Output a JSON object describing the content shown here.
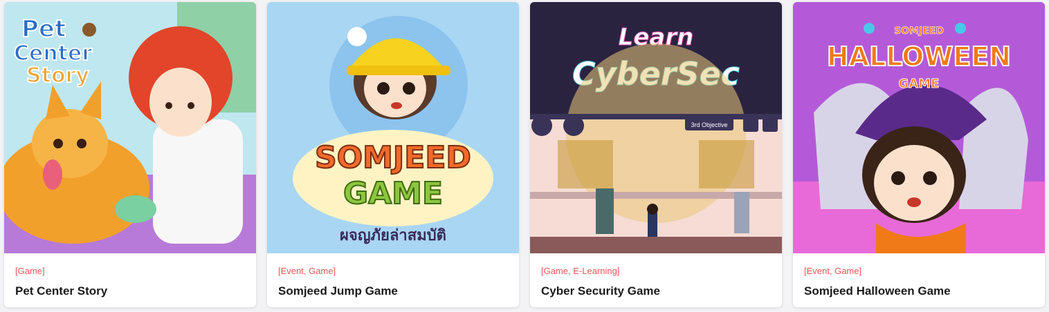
{
  "cards": [
    {
      "category": "[Game]",
      "title": "Pet Center Story",
      "art": {
        "logo_line1": "Pet",
        "logo_line2": "Center",
        "logo_line3": "Story",
        "bg": "#bfe7f0",
        "accent": "#f2a02c"
      }
    },
    {
      "category": "[Event, Game]",
      "title": "Somjeed Jump Game",
      "art": {
        "logo_line1": "SOMJEED",
        "logo_line2": "GAME",
        "subtitle_th": "ผจญภัยล่าสมบัติ",
        "bg": "#a9d6f3",
        "accent": "#f26a2b"
      }
    },
    {
      "category": "[Game, E-Learning]",
      "title": "Cyber Security Game",
      "art": {
        "logo_line1": "Learn",
        "logo_line2": "CyberSec",
        "objective_label": "3rd Objective",
        "bg": "#2a2340",
        "accent": "#e9c878"
      }
    },
    {
      "category": "[Event, Game]",
      "title": "Somjeed Halloween Game",
      "art": {
        "brand": "SOMJEED",
        "logo_line1": "HALLOWEEN",
        "logo_line2": "GAME",
        "bg": "#b45ad8",
        "accent": "#f07a18"
      }
    }
  ]
}
